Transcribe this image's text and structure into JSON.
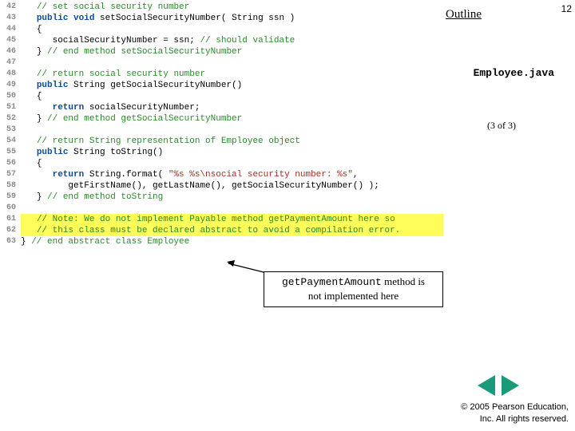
{
  "page_number": "12",
  "outline_title": "Outline",
  "file_name": "Employee.java",
  "page_of": "(3 of 3)",
  "callout": {
    "mono": "getPaymentAmount",
    "rest1": " method is",
    "rest2": "not implemented here"
  },
  "copyright": {
    "line1": "© 2005 Pearson Education,",
    "line2": "Inc. All rights reserved."
  },
  "code_lines": [
    {
      "n": "42",
      "tokens": [
        [
          "ind",
          "   "
        ],
        [
          "comment",
          "// set social security number"
        ]
      ]
    },
    {
      "n": "43",
      "tokens": [
        [
          "ind",
          "   "
        ],
        [
          "keyword",
          "public void"
        ],
        [
          "plain",
          " setSocialSecurityNumber( String ssn )"
        ]
      ]
    },
    {
      "n": "44",
      "tokens": [
        [
          "ind",
          "   "
        ],
        [
          "plain",
          "{"
        ]
      ]
    },
    {
      "n": "45",
      "tokens": [
        [
          "ind",
          "      "
        ],
        [
          "plain",
          "socialSecurityNumber = ssn; "
        ],
        [
          "comment",
          "// should validate"
        ]
      ]
    },
    {
      "n": "46",
      "tokens": [
        [
          "ind",
          "   "
        ],
        [
          "plain",
          "} "
        ],
        [
          "comment",
          "// end method setSocialSecurityNumber"
        ]
      ]
    },
    {
      "n": "47",
      "tokens": []
    },
    {
      "n": "48",
      "tokens": [
        [
          "ind",
          "   "
        ],
        [
          "comment",
          "// return social security number"
        ]
      ]
    },
    {
      "n": "49",
      "tokens": [
        [
          "ind",
          "   "
        ],
        [
          "keyword",
          "public"
        ],
        [
          "plain",
          " String getSocialSecurityNumber()"
        ]
      ]
    },
    {
      "n": "50",
      "tokens": [
        [
          "ind",
          "   "
        ],
        [
          "plain",
          "{"
        ]
      ]
    },
    {
      "n": "51",
      "tokens": [
        [
          "ind",
          "      "
        ],
        [
          "keyword",
          "return"
        ],
        [
          "plain",
          " socialSecurityNumber;"
        ]
      ]
    },
    {
      "n": "52",
      "tokens": [
        [
          "ind",
          "   "
        ],
        [
          "plain",
          "} "
        ],
        [
          "comment",
          "// end method getSocialSecurityNumber"
        ]
      ]
    },
    {
      "n": "53",
      "tokens": []
    },
    {
      "n": "54",
      "tokens": [
        [
          "ind",
          "   "
        ],
        [
          "comment",
          "// return String representation of Employee object"
        ]
      ]
    },
    {
      "n": "55",
      "tokens": [
        [
          "ind",
          "   "
        ],
        [
          "keyword",
          "public"
        ],
        [
          "plain",
          " String toString()"
        ]
      ]
    },
    {
      "n": "56",
      "tokens": [
        [
          "ind",
          "   "
        ],
        [
          "plain",
          "{"
        ]
      ]
    },
    {
      "n": "57",
      "tokens": [
        [
          "ind",
          "      "
        ],
        [
          "keyword",
          "return"
        ],
        [
          "plain",
          " String.format( "
        ],
        [
          "string",
          "\"%s %s\\nsocial security number: %s\""
        ],
        [
          "plain",
          ","
        ]
      ]
    },
    {
      "n": "58",
      "tokens": [
        [
          "ind",
          "         "
        ],
        [
          "plain",
          "getFirstName(), getLastName(), getSocialSecurityNumber() );"
        ]
      ]
    },
    {
      "n": "59",
      "tokens": [
        [
          "ind",
          "   "
        ],
        [
          "plain",
          "} "
        ],
        [
          "comment",
          "// end method toString"
        ]
      ]
    },
    {
      "n": "60",
      "tokens": []
    },
    {
      "n": "61",
      "hl": true,
      "tokens": [
        [
          "ind",
          "   "
        ],
        [
          "comment",
          "// Note: We do not implement Payable method getPaymentAmount here so"
        ]
      ]
    },
    {
      "n": "62",
      "hl": true,
      "tokens": [
        [
          "ind",
          "   "
        ],
        [
          "comment",
          "// this class must be declared abstract to avoid a compilation error."
        ]
      ]
    },
    {
      "n": "63",
      "tokens": [
        [
          "plain",
          "} "
        ],
        [
          "comment",
          "// end abstract class Employee"
        ]
      ]
    }
  ]
}
